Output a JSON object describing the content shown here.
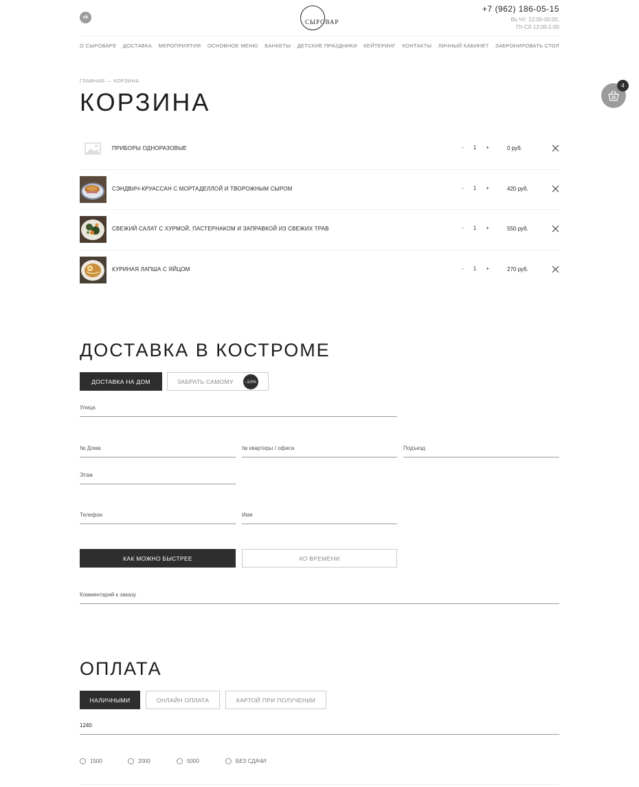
{
  "header": {
    "vk_label": "vk",
    "logo_text": "СЫРОВАР",
    "phone": "+7 (962) 186-05-15",
    "hours_line1": "Вс-Чт: 12:00-00:00,",
    "hours_line2": "Пт-Сб 12:00-1:00"
  },
  "nav": [
    "О СЫРОВАРЕ",
    "ДОСТАВКА",
    "МЕРОПРИЯТИЯ",
    "ОСНОВНОЕ МЕНЮ",
    "БАНКЕТЫ",
    "ДЕТСКИЕ ПРАЗДНИКИ",
    "КЕЙТЕРИНГ",
    "КОНТАКТЫ",
    "ЛИЧНЫЙ КАБИНЕТ",
    "ЗАБРОНИРОВАТЬ СТОЛ"
  ],
  "cart_widget": {
    "count": "4",
    "icon": "basket-icon"
  },
  "breadcrumbs": {
    "home": "ГЛАВНАЯ",
    "sep": "—",
    "current": "КОРЗИНА"
  },
  "page_title": "КОРЗИНА",
  "cart_items": [
    {
      "name": "ПРИБОРЫ ОДНОРАЗОВЫЕ",
      "minus": "-",
      "qty": "1",
      "plus": "+",
      "price": "0 руб."
    },
    {
      "name": "СЭНДВИЧ-КРУАССАН С МОРТАДЕЛЛОЙ И ТВОРОЖНЫМ СЫРОМ",
      "minus": "-",
      "qty": "1",
      "plus": "+",
      "price": "420 руб."
    },
    {
      "name": "СВЕЖИЙ САЛАТ С ХУРМОЙ, ПАСТЕРНАКОМ И ЗАПРАВКОЙ ИЗ СВЕЖИХ ТРАВ",
      "minus": "-",
      "qty": "1",
      "plus": "+",
      "price": "550 руб."
    },
    {
      "name": "КУРИНАЯ ЛАПША С ЯЙЦОМ",
      "minus": "-",
      "qty": "1",
      "plus": "+",
      "price": "270 руб."
    }
  ],
  "delivery": {
    "title": "ДОСТАВКА В КОСТРОМЕ",
    "tab_home": "ДОСТАВКА НА ДОМ",
    "tab_pickup": "ЗАБРАТЬ САМОМУ",
    "pickup_discount": "-10%",
    "fields": {
      "street": "Улица",
      "house": "№ Дома",
      "apartment": "№ квартиры / офиса",
      "entrance": "Подъезд",
      "floor": "Этаж",
      "phone": "Телефон",
      "name": "Имя",
      "comment": "Комментарий к заказу"
    },
    "asap": "КАК МОЖНО БЫСТРЕЕ",
    "by_time": "КО ВРЕМЕНИ"
  },
  "payment": {
    "title": "ОПЛАТА",
    "cash": "НАЛИЧНЫМИ",
    "online": "ОНЛАЙН ОПЛАТА",
    "card": "КАРТОЙ ПРИ ПОЛУЧЕНИИ",
    "amount": "1240",
    "change_options": [
      "1500",
      "2000",
      "5000",
      "БЕЗ СДАЧИ"
    ]
  },
  "colors": {
    "dark": "#2e2e2e",
    "muted": "#999999",
    "widget": "#9b9b9b"
  }
}
